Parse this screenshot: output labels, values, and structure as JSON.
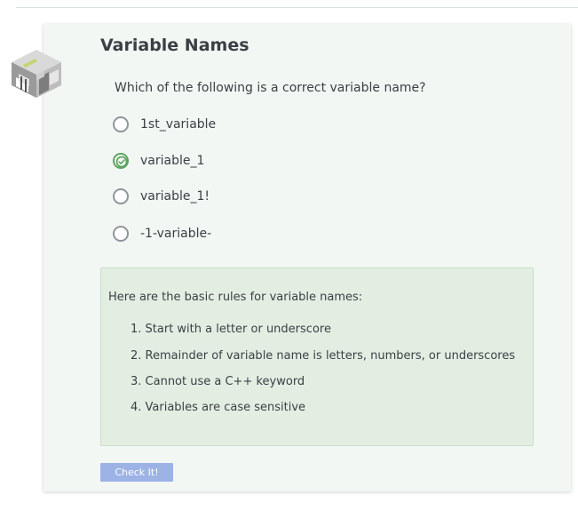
{
  "activity": {
    "title": "Variable Names",
    "question": "Which of the following is a correct variable name?",
    "options": [
      {
        "label": "1st_variable",
        "selected": false
      },
      {
        "label": "variable_1",
        "selected": true
      },
      {
        "label": "variable_1!",
        "selected": false
      },
      {
        "label": "-1-variable-",
        "selected": false
      }
    ],
    "feedback": {
      "intro": "Here are the basic rules for variable names:",
      "rules": [
        "1. Start with a letter or underscore",
        "2. Remainder of variable name is letters, numbers, or underscores",
        "3. Cannot use a C++ keyword",
        "4. Variables are case sensitive"
      ]
    },
    "check_button_label": "Check It!"
  },
  "icons": {
    "logo": "isometric-room-logo-icon",
    "selected_radio": "check-circle-icon",
    "unselected_radio": "radio-empty-icon"
  },
  "colors": {
    "card_background": "#f2f7f3",
    "feedback_background": "#e3eee3",
    "selected_accent": "#5aa55e",
    "button_background": "#9db3e6",
    "text": "#3b3f45"
  }
}
